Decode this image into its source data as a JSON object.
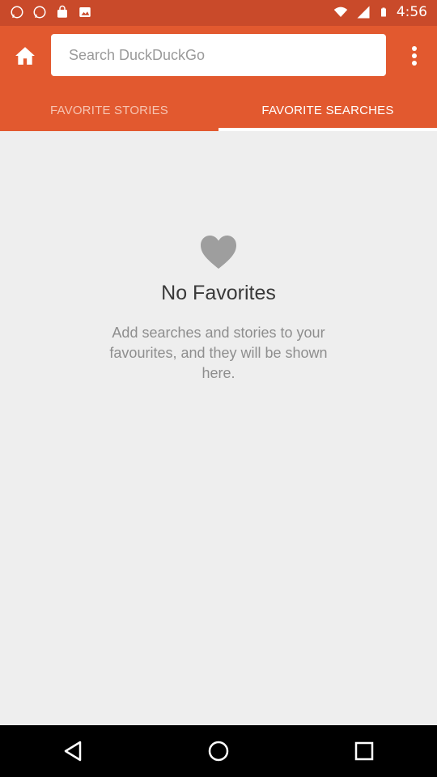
{
  "status_bar": {
    "time": "4:56",
    "icons_left": [
      "whatsapp-icon",
      "whatsapp-icon",
      "shopping-bag-icon",
      "photo-icon"
    ],
    "icons_right": [
      "wifi-icon",
      "signal-icon",
      "battery-icon"
    ]
  },
  "header": {
    "search": {
      "placeholder": "Search DuckDuckGo",
      "value": ""
    },
    "icons": {
      "home": "home-icon",
      "menu": "overflow-menu-icon"
    }
  },
  "tabs": [
    {
      "label": "FAVORITE STORIES",
      "active": false
    },
    {
      "label": "FAVORITE SEARCHES",
      "active": true
    }
  ],
  "empty_state": {
    "icon": "heart-icon",
    "title": "No Favorites",
    "description": "Add searches and stories to your favourites, and they will be shown here."
  },
  "colors": {
    "app_bar": "#e2592f",
    "status_bar": "#c94a2a",
    "background": "#eeeeee"
  },
  "nav_bar": {
    "icons": [
      "back-icon",
      "home-circle-icon",
      "recents-icon"
    ]
  }
}
